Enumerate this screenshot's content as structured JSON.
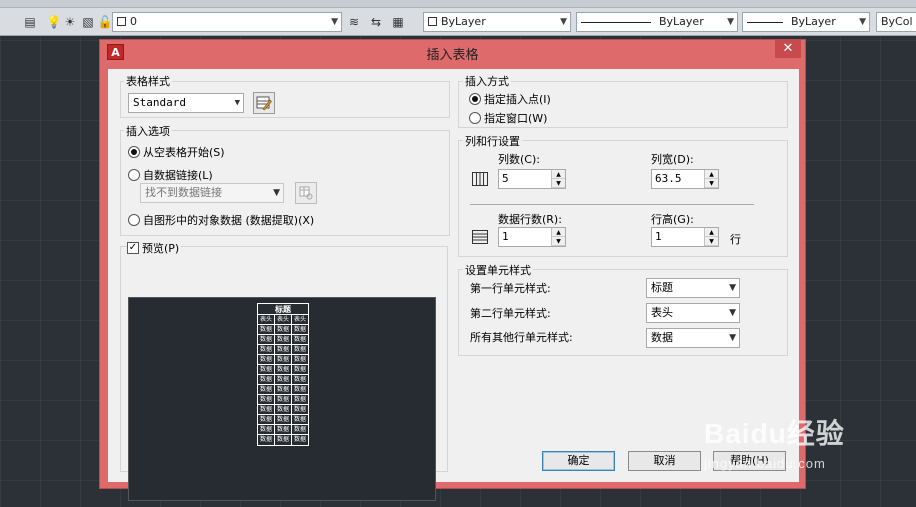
{
  "toolbar": {
    "layer_value": "0",
    "color_value": "ByLayer",
    "linetype_value": "ByLayer",
    "lineweight_value": "ByLayer",
    "plotstyle_value": "ByCol"
  },
  "dialog": {
    "title": "插入表格",
    "close_glyph": "✕",
    "app_icon_letter": "A"
  },
  "table_style": {
    "group_label": "表格样式",
    "selected": "Standard"
  },
  "insert_options": {
    "group_label": "插入选项",
    "from_empty": "从空表格开始(S)",
    "from_link": "自数据链接(L)",
    "link_placeholder": "找不到数据链接",
    "from_objects": "自图形中的对象数据 (数据提取)(X)",
    "selected": "from_empty"
  },
  "preview": {
    "label": "预览(P)",
    "checked": true,
    "title": "标题",
    "header_cells": [
      "表头",
      "表头",
      "表头"
    ],
    "data_cell": "数据",
    "data_rows": 12
  },
  "insert_method": {
    "group_label": "插入方式",
    "point": "指定插入点(I)",
    "window": "指定窗口(W)",
    "selected": "point"
  },
  "rows_columns": {
    "group_label": "列和行设置",
    "columns_label": "列数(C):",
    "columns_value": "5",
    "col_width_label": "列宽(D):",
    "col_width_value": "63.5",
    "data_rows_label": "数据行数(R):",
    "data_rows_value": "1",
    "row_height_label": "行高(G):",
    "row_height_value": "1",
    "row_unit": "行"
  },
  "cell_styles": {
    "group_label": "设置单元样式",
    "first_row_label": "第一行单元样式:",
    "first_row_value": "标题",
    "second_row_label": "第二行单元样式:",
    "second_row_value": "表头",
    "other_rows_label": "所有其他行单元样式:",
    "other_rows_value": "数据"
  },
  "buttons": {
    "ok": "确定",
    "cancel": "取消",
    "help": "帮助(H)"
  },
  "watermark": {
    "brand": "Baidu经验",
    "url": "jingyan.baidu.com"
  }
}
